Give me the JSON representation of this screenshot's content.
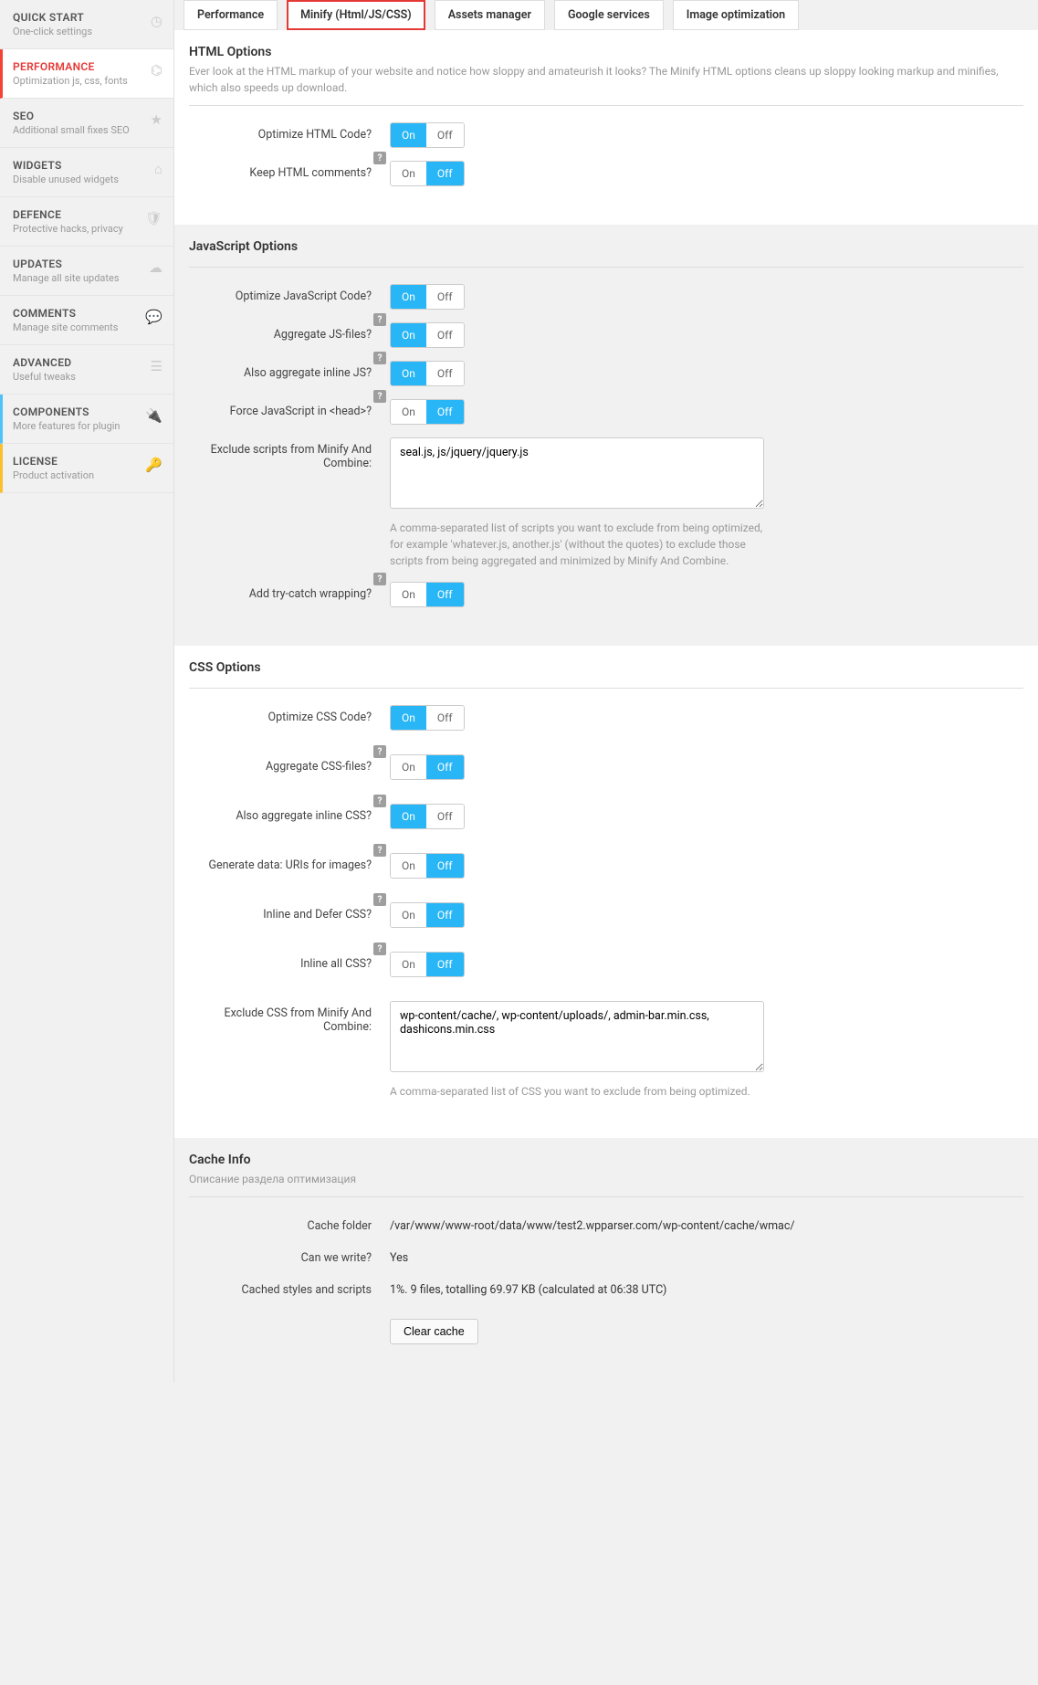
{
  "sidebar": {
    "items": [
      {
        "title": "QUICK START",
        "sub": "One-click settings",
        "icon": "◷"
      },
      {
        "title": "PERFORMANCE",
        "sub": "Optimization js, css, fonts",
        "icon": "⌬"
      },
      {
        "title": "SEO",
        "sub": "Additional small fixes SEO",
        "icon": "★"
      },
      {
        "title": "WIDGETS",
        "sub": "Disable unused widgets",
        "icon": "⌂"
      },
      {
        "title": "DEFENCE",
        "sub": "Protective hacks, privacy",
        "icon": "🛡"
      },
      {
        "title": "UPDATES",
        "sub": "Manage all site updates",
        "icon": "☁"
      },
      {
        "title": "COMMENTS",
        "sub": "Manage site comments",
        "icon": "💬"
      },
      {
        "title": "ADVANCED",
        "sub": "Useful tweaks",
        "icon": "☰"
      },
      {
        "title": "COMPONENTS",
        "sub": "More features for plugin",
        "icon": "🔌"
      },
      {
        "title": "LICENSE",
        "sub": "Product activation",
        "icon": "🔑"
      }
    ]
  },
  "tabs": [
    "Performance",
    "Minify (Html/JS/CSS)",
    "Assets manager",
    "Google services",
    "Image optimization"
  ],
  "toggle_labels": {
    "on": "On",
    "off": "Off"
  },
  "html_section": {
    "title": "HTML Options",
    "desc": "Ever look at the HTML markup of your website and notice how sloppy and amateurish it looks? The Minify HTML options cleans up sloppy looking markup and minifies, which also speeds up download.",
    "rows": [
      {
        "label": "Optimize HTML Code?",
        "on": true,
        "help": false
      },
      {
        "label": "Keep HTML comments?",
        "on": false,
        "help": true
      }
    ]
  },
  "js_section": {
    "title": "JavaScript Options",
    "rows": [
      {
        "label": "Optimize JavaScript Code?",
        "on": true,
        "help": false
      },
      {
        "label": "Aggregate JS-files?",
        "on": true,
        "help": true
      },
      {
        "label": "Also aggregate inline JS?",
        "on": true,
        "help": true
      },
      {
        "label": "Force JavaScript in <head>?",
        "on": false,
        "help": true
      }
    ],
    "exclude_label": "Exclude scripts from Minify And Combine:",
    "exclude_value": "seal.js, js/jquery/jquery.js",
    "exclude_hint": "A comma-separated list of scripts you want to exclude from being optimized, for example 'whatever.js, another.js' (without the quotes) to exclude those scripts from being aggregated and minimized by Minify And Combine.",
    "trycatch": {
      "label": "Add try-catch wrapping?",
      "on": false,
      "help": true
    }
  },
  "css_section": {
    "title": "CSS Options",
    "rows": [
      {
        "label": "Optimize CSS Code?",
        "on": true,
        "help": false
      },
      {
        "label": "Aggregate CSS-files?",
        "on": false,
        "help": true
      },
      {
        "label": "Also aggregate inline CSS?",
        "on": true,
        "help": true
      },
      {
        "label": "Generate data: URIs for images?",
        "on": false,
        "help": true
      },
      {
        "label": "Inline and Defer CSS?",
        "on": false,
        "help": true
      },
      {
        "label": "Inline all CSS?",
        "on": false,
        "help": true
      }
    ],
    "exclude_label": "Exclude CSS from Minify And Combine:",
    "exclude_value": "wp-content/cache/, wp-content/uploads/, admin-bar.min.css, dashicons.min.css",
    "exclude_hint": "A comma-separated list of CSS you want to exclude from being optimized."
  },
  "cache_section": {
    "title": "Cache Info",
    "desc": "Описание раздела оптимизация",
    "rows": [
      {
        "label": "Cache folder",
        "value": "/var/www/www-root/data/www/test2.wpparser.com/wp-content/cache/wmac/"
      },
      {
        "label": "Can we write?",
        "value": "Yes"
      },
      {
        "label": "Cached styles and scripts",
        "value": "1%. 9 files, totalling 69.97 KB (calculated at 06:38 UTC)"
      }
    ],
    "clear_button": "Clear cache"
  }
}
